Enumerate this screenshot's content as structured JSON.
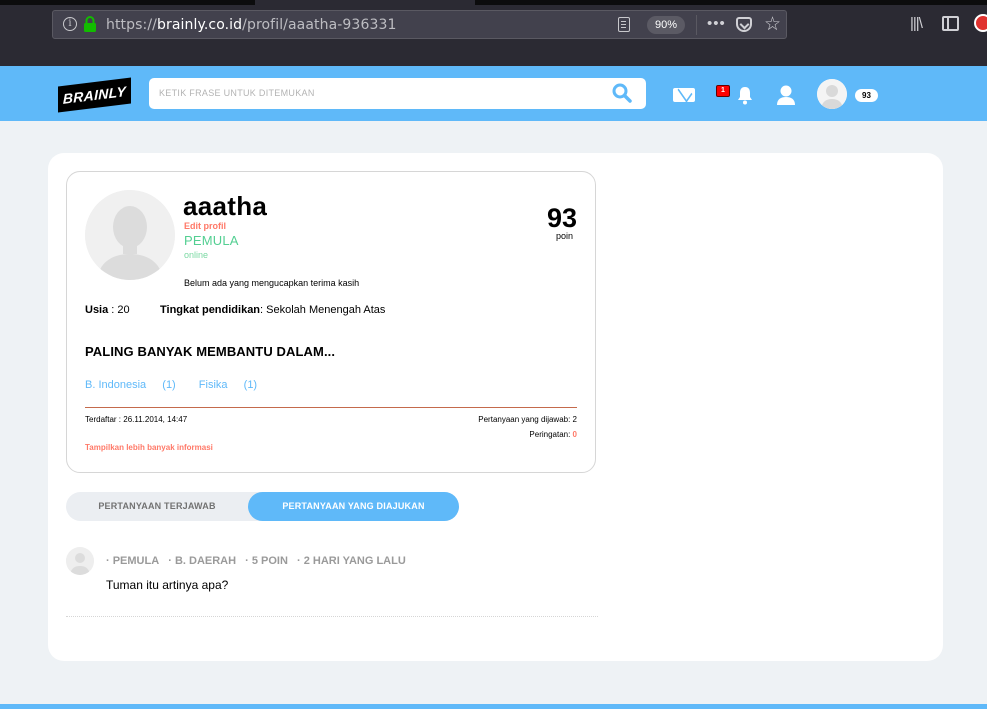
{
  "browser": {
    "url_scheme": "https://",
    "url_host": "brainly.co.id",
    "url_path": "/profil/aaatha-936331",
    "zoom": "90%"
  },
  "header": {
    "logo": "BRAINLY",
    "search_placeholder": "KETIK FRASE UNTUK DITEMUKAN",
    "notification_count": "1",
    "points": "93",
    "accent_color": "#5fb9f9"
  },
  "profile": {
    "username": "aaatha",
    "edit_label": "Edit profil",
    "rank": "PEMULA",
    "status": "online",
    "thanks": "Belum ada yang mengucapkan terima kasih",
    "points": "93",
    "points_label": "poin",
    "age_label": "Usia",
    "age_value": " : 20",
    "edu_label": "Tingkat pendidikan",
    "edu_value": ": Sekolah Menengah Atas",
    "help_heading": "PALING BANYAK MEMBANTU DALAM...",
    "subjects": [
      {
        "name": "B. Indonesia",
        "count": "(1)"
      },
      {
        "name": "Fisika",
        "count": "(1)"
      }
    ],
    "joined": "Terdaftar : 26.11.2014, 14:47",
    "answered_label": "Pertanyaan yang dijawab: 2",
    "warnings_label": "Peringatan: ",
    "warnings_value": "0",
    "more_info": "Tampilkan lebih banyak informasi"
  },
  "tabs": {
    "answered": "PERTANYAAN TERJAWAB",
    "asked": "PERTANYAAN YANG DIAJUKAN"
  },
  "questions": [
    {
      "rank": "· PEMULA",
      "subject": "· B. DAERAH",
      "points": "· 5 POIN",
      "time": "· 2 HARI YANG LALU",
      "text": "Tuman itu artinya apa?"
    }
  ]
}
